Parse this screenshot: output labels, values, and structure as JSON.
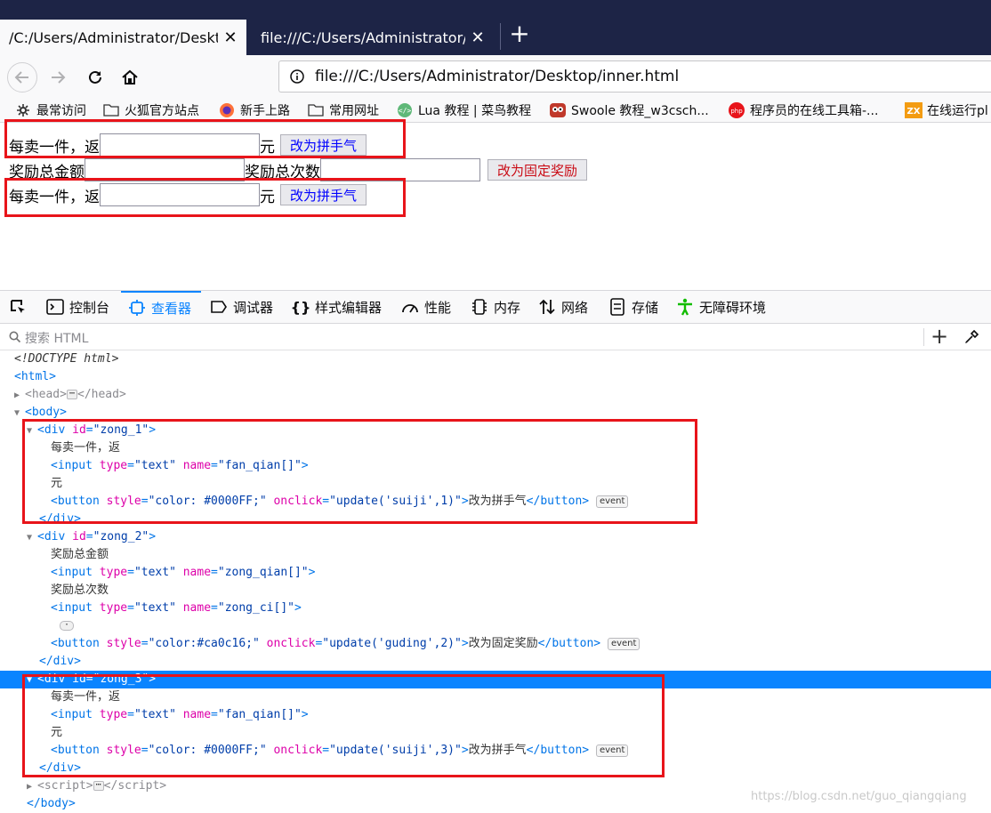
{
  "tabs": [
    {
      "label": "/C:/Users/Administrator/Desktop",
      "close": "✕"
    },
    {
      "label": "file:///C:/Users/Administrator/De",
      "close": "✕"
    }
  ],
  "new_tab": "+",
  "url": "file:///C:/Users/Administrator/Desktop/inner.html",
  "bookmarks": [
    {
      "label": "最常访问",
      "icon": "gear-icon"
    },
    {
      "label": "火狐官方站点",
      "icon": "folder-icon"
    },
    {
      "label": "新手上路",
      "icon": "firefox-icon"
    },
    {
      "label": "常用网址",
      "icon": "folder-icon"
    },
    {
      "label": "Lua 教程 | 菜鸟教程",
      "icon": "runoob-icon"
    },
    {
      "label": "Swoole 教程_w3csch...",
      "icon": "w3c-owl-icon"
    },
    {
      "label": "程序员的在线工具箱-...",
      "icon": "php-icon"
    },
    {
      "label": "在线运行pl",
      "icon": "zx-icon"
    }
  ],
  "page": {
    "row1": {
      "prefix": "每卖一件，返",
      "suffix": "元",
      "button": "改为拼手气",
      "button_color": "#0000FF"
    },
    "row2": {
      "label1": "奖励总金额",
      "label2": "奖励总次数",
      "button": "改为固定奖励",
      "button_color": "#ca0c16"
    },
    "row3": {
      "prefix": "每卖一件，返",
      "suffix": "元",
      "button": "改为拼手气",
      "button_color": "#0000FF"
    }
  },
  "devtools": {
    "tabs": [
      "控制台",
      "查看器",
      "调试器",
      "样式编辑器",
      "性能",
      "内存",
      "网络",
      "存储",
      "无障碍环境"
    ],
    "active_tab": "查看器",
    "search_placeholder": "搜索 HTML"
  },
  "markup": {
    "doctype": "<!DOCTYPE html>",
    "html": "html",
    "head": "head",
    "body": "body",
    "script": "script",
    "div_attr_name": "id",
    "div_ids": [
      "\"zong_1\"",
      "\"zong_2\"",
      "\"zong_3\""
    ],
    "text_fanhuan": "每卖一件，返",
    "text_yuan": "元",
    "text_total_amount": "奖励总金额",
    "text_total_count": "奖励总次数",
    "input_type_value": "\"text\"",
    "input_name_fan": "\"fan_qian[]\"",
    "input_name_zong_qian": "\"zong_qian[]\"",
    "input_name_zong_ci": "\"zong_ci[]\"",
    "btn_style_blue": "\"color: #0000FF;\"",
    "btn_style_red": "\"color:#ca0c16;\"",
    "btn_onclick_1": "\"update('suiji',1)\"",
    "btn_onclick_2": "\"update('guding',2)\"",
    "btn_onclick_3": "\"update('suiji',3)\"",
    "btn_text_pin": "改为拼手气",
    "btn_text_gu": "改为固定奖励",
    "event_badge": "event"
  },
  "watermark": "https://blog.csdn.net/guo_qiangqiang",
  "highlight_color": "#e8141a",
  "selection_color": "#0a84ff"
}
